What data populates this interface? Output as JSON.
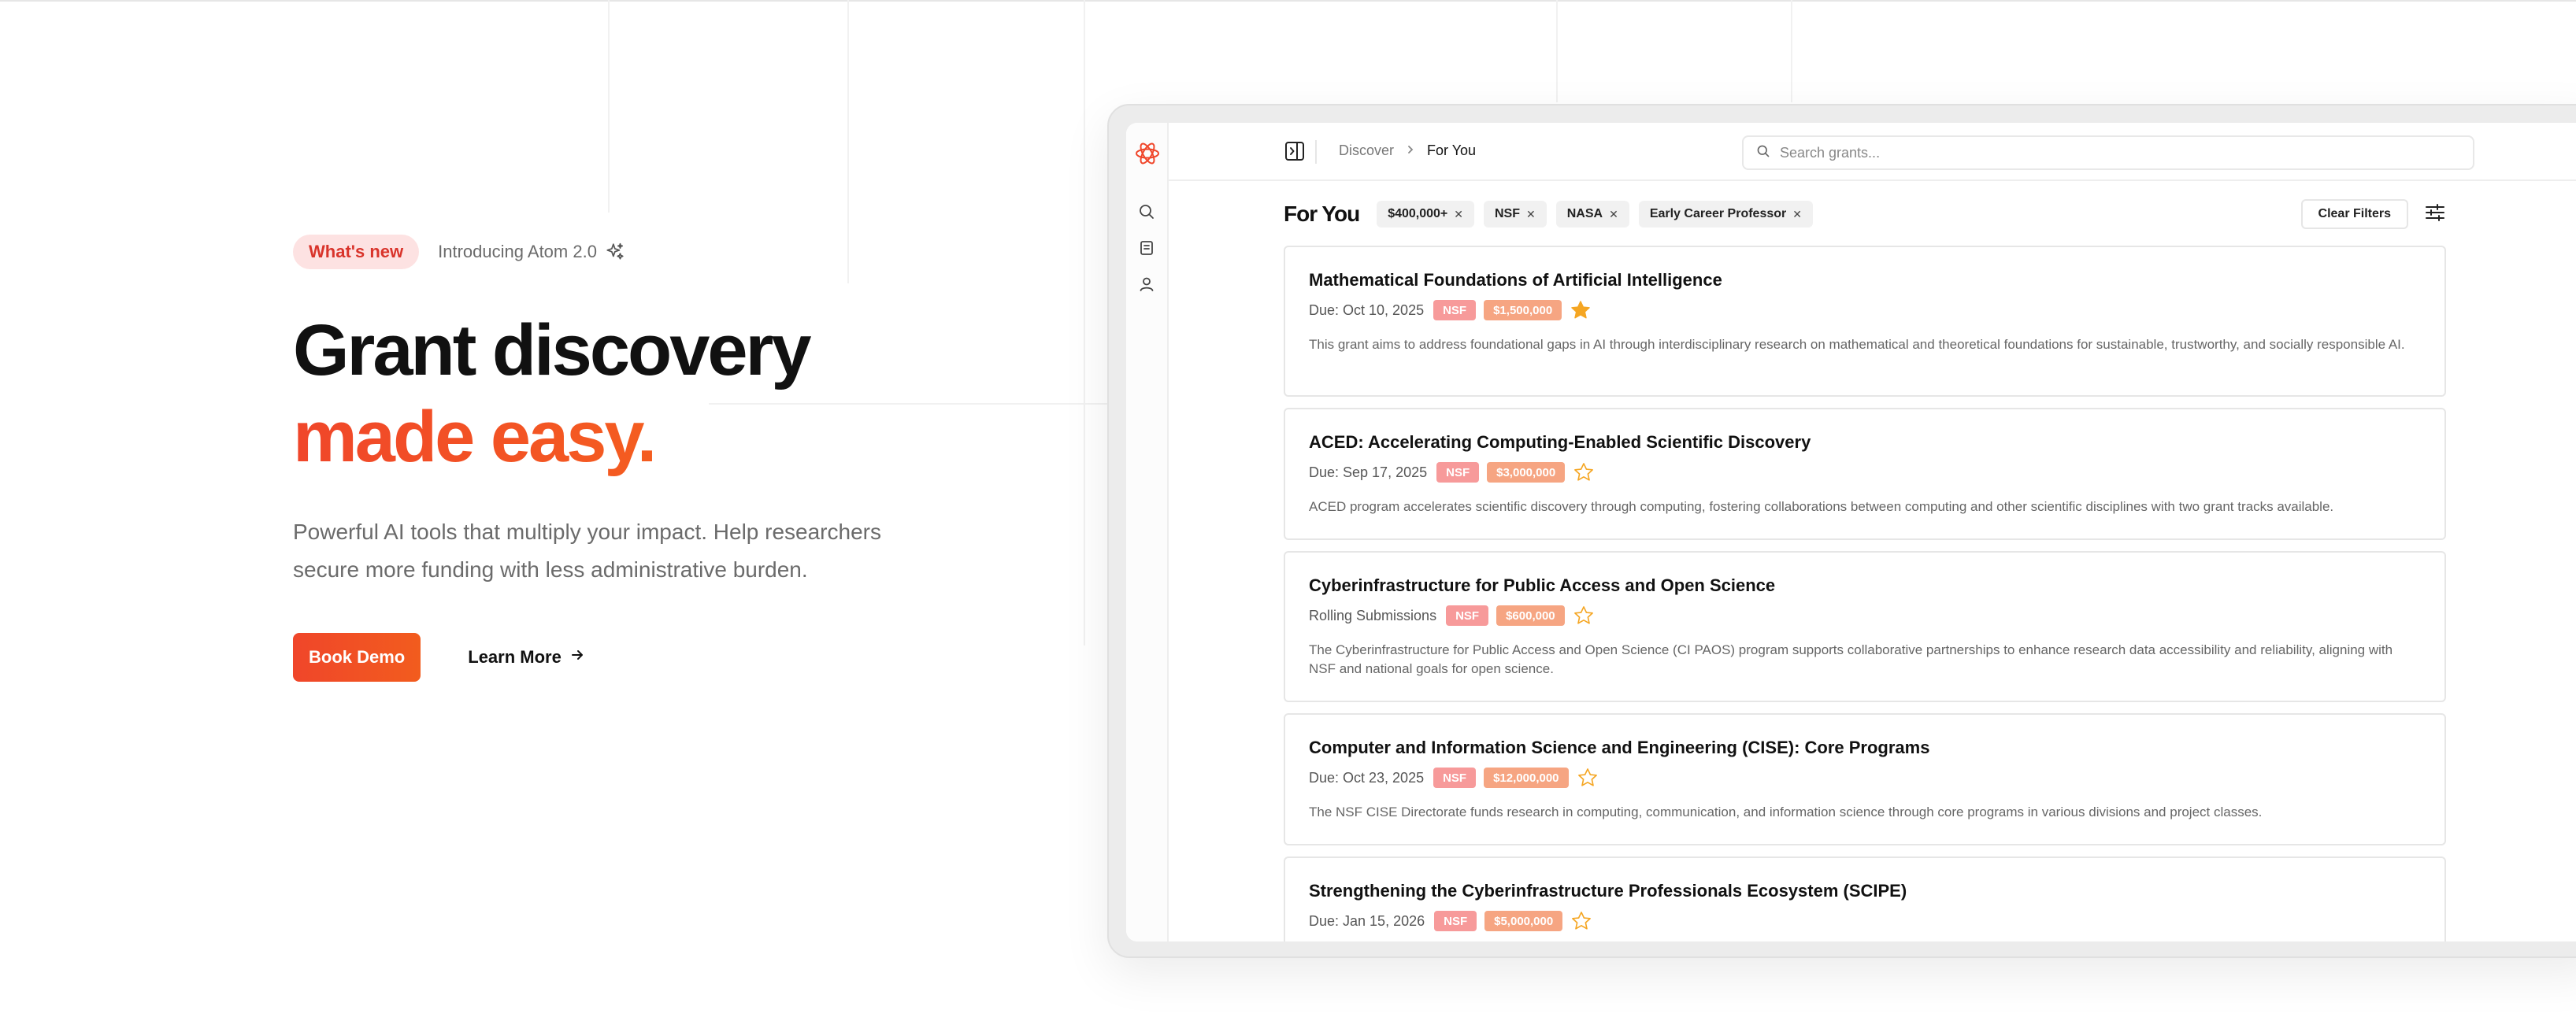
{
  "hero": {
    "badge": "What's new",
    "announcement": "Introducing Atom 2.0",
    "headline_line1": "Grant discovery",
    "headline_line2": "made easy.",
    "subtitle": "Powerful AI tools that multiply your impact. Help researchers secure more funding with less administrative burden.",
    "primary_cta": "Book Demo",
    "secondary_cta": "Learn More"
  },
  "app": {
    "breadcrumb": [
      "Discover",
      "For You"
    ],
    "search_placeholder": "Search grants...",
    "section_title": "For You",
    "filters": [
      "$400,000+",
      "NSF",
      "NASA",
      "Early Career Professor"
    ],
    "clear_filters": "Clear Filters",
    "grants": [
      {
        "title": "Mathematical Foundations of Artificial Intelligence",
        "due": "Due: Oct 10, 2025",
        "agency": "NSF",
        "amount": "$1,500,000",
        "starred": true,
        "description": "This grant aims to address foundational gaps in AI through interdisciplinary research on mathematical and theoretical foundations for sustainable, trustworthy, and socially responsible AI."
      },
      {
        "title": "ACED: Accelerating Computing-Enabled Scientific Discovery",
        "due": "Due: Sep 17, 2025",
        "agency": "NSF",
        "amount": "$3,000,000",
        "starred": false,
        "description": "ACED program accelerates scientific discovery through computing, fostering collaborations between computing and other scientific disciplines with two grant tracks available."
      },
      {
        "title": "Cyberinfrastructure for Public Access and Open Science",
        "due": "Rolling Submissions",
        "agency": "NSF",
        "amount": "$600,000",
        "starred": false,
        "description": "The Cyberinfrastructure for Public Access and Open Science (CI PAOS) program supports collaborative partnerships to enhance research data accessibility and reliability, aligning with NSF and national goals for open science."
      },
      {
        "title": "Computer and Information Science and Engineering (CISE): Core Programs",
        "due": "Due: Oct 23, 2025",
        "agency": "NSF",
        "amount": "$12,000,000",
        "starred": false,
        "description": "The NSF CISE Directorate funds research in computing, communication, and information science through core programs in various divisions and project classes."
      },
      {
        "title": "Strengthening the Cyberinfrastructure Professionals Ecosystem (SCIPE)",
        "due": "Due: Jan 15, 2026",
        "agency": "NSF",
        "amount": "$5,000,000",
        "starred": false,
        "description": ""
      }
    ]
  },
  "colors": {
    "accent": "#f0462a",
    "accent_orange": "#f97316",
    "agency_tag": "#f79a9a",
    "amount_tag": "#f6a582",
    "star": "#f5a623"
  },
  "icons": {
    "logo": "atom-logo-icon",
    "rail": [
      "search-icon",
      "document-icon",
      "user-icon"
    ],
    "sidebar_toggle": "panel-toggle-icon",
    "filter_settings": "sliders-icon"
  }
}
